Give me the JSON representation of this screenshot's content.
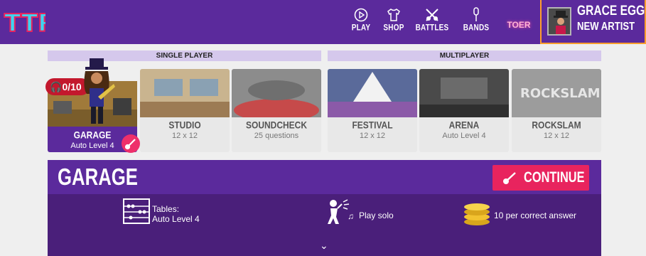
{
  "header": {
    "logo_text": "TTRS",
    "nav": [
      {
        "label": "PLAY",
        "icon": "play-icon"
      },
      {
        "label": "SHOP",
        "icon": "tshirt-icon"
      },
      {
        "label": "BATTLES",
        "icon": "crossed-guitars-icon"
      },
      {
        "label": "BANDS",
        "icon": "microphone-icon"
      }
    ],
    "tour_label": "TOER",
    "profile": {
      "name": "GRACE EGG",
      "rank": "NEW ARTIST"
    }
  },
  "sections": {
    "single": "SINGLE PLAYER",
    "multi": "MULTIPLAYER"
  },
  "modes": [
    {
      "title": "GARAGE",
      "sub": "Auto Level 4",
      "badge": "0/10",
      "selected": true
    },
    {
      "title": "STUDIO",
      "sub": "12 x 12"
    },
    {
      "title": "SOUNDCHECK",
      "sub": "25 questions"
    },
    {
      "title": "FESTIVAL",
      "sub": "12 x 12"
    },
    {
      "title": "ARENA",
      "sub": "Auto Level 4"
    },
    {
      "title": "ROCKSLAM",
      "sub": "12 x 12"
    }
  ],
  "detail": {
    "title": "GARAGE",
    "continue_label": "CONTINUE",
    "tables_label": "Tables:",
    "tables_value": "Auto Level 4",
    "play_mode": "Play solo",
    "reward": "10 per correct answer"
  },
  "colors": {
    "purple": "#5b2a9c",
    "dark_purple": "#4a1f7a",
    "pink": "#e8245e",
    "orange": "#ff9e2c"
  }
}
